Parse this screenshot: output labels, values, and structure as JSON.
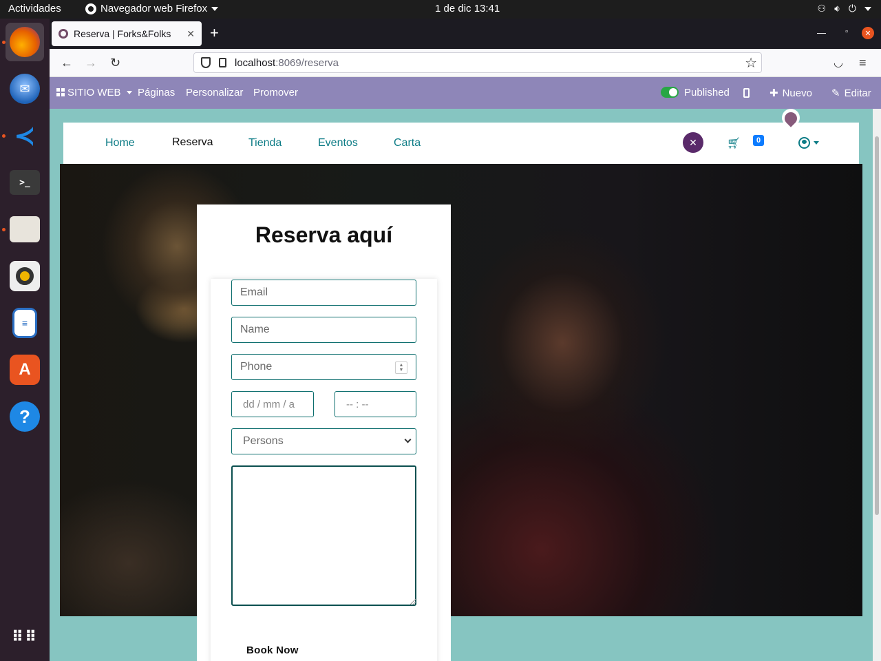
{
  "system_bar": {
    "activities": "Actividades",
    "app_menu": "Navegador web Firefox",
    "clock": "1 de dic  13:41"
  },
  "dock": {
    "apps": [
      {
        "name": "firefox-icon",
        "color": "#e66000"
      },
      {
        "name": "thunderbird-icon",
        "color": "#1f63b8"
      },
      {
        "name": "vscode-icon",
        "color": "#1e88e5"
      },
      {
        "name": "terminal-icon",
        "color": "#3a3a3a"
      },
      {
        "name": "files-icon",
        "color": "#d8d4cc"
      },
      {
        "name": "rhythmbox-icon",
        "color": "#f0b400"
      },
      {
        "name": "writer-icon",
        "color": "#2a6fc4"
      },
      {
        "name": "software-icon",
        "color": "#e95420"
      },
      {
        "name": "help-icon",
        "color": "#1e88e5"
      }
    ]
  },
  "browser": {
    "tab_title": "Reserva | Forks&Folks",
    "tab_close": "✕",
    "new_tab": "+",
    "url_host": "localhost",
    "url_path": ":8069/reserva"
  },
  "odoo_bar": {
    "site_menu": "SITIO WEB",
    "pages": "Páginas",
    "customize": "Personalizar",
    "promote": "Promover",
    "published": "Published",
    "new": "Nuevo",
    "edit": "Editar"
  },
  "site_nav": {
    "items": [
      "Home",
      "Reserva",
      "Tienda",
      "Eventos",
      "Carta"
    ],
    "cart_count": "0"
  },
  "reservation_form": {
    "title": "Reserva aquí",
    "email_placeholder": "Email",
    "name_placeholder": "Name",
    "phone_placeholder": "Phone",
    "date_placeholder": "dd / mm / a",
    "time_placeholder": "-- : --",
    "persons_placeholder": "Persons",
    "message_value": "",
    "submit_label": "Book Now"
  },
  "colors": {
    "odoo_bar": "#8e86b8",
    "page_background": "#86c5c1",
    "link": "#0d7c86",
    "accent": "#875a7b"
  }
}
